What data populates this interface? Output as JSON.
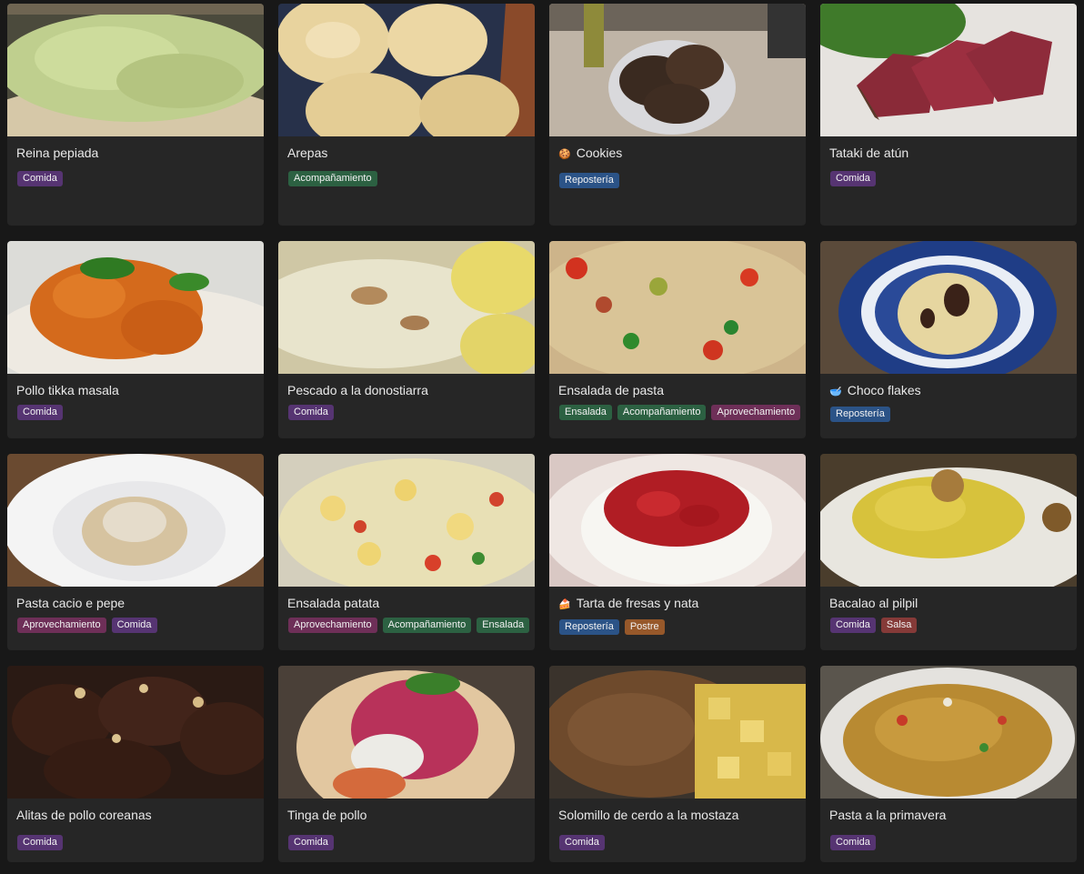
{
  "tag_colors": {
    "Comida": "#563472",
    "Acompañamiento": "#2c6142",
    "Repostería": "#2b5387",
    "Aprovechamiento": "#6e2f58",
    "Ensalada": "#2c6142",
    "Postre": "#97582a",
    "Salsa": "#853a38"
  },
  "recipes": [
    {
      "title": "Reina pepiada",
      "emoji": "",
      "tags": [
        "Comida"
      ]
    },
    {
      "title": "Arepas",
      "emoji": "",
      "tags": [
        "Acompañamiento"
      ]
    },
    {
      "title": "Cookies",
      "emoji": "🍪",
      "tags": [
        "Repostería"
      ]
    },
    {
      "title": "Tataki de atún",
      "emoji": "",
      "tags": [
        "Comida"
      ]
    },
    {
      "title": "Pollo tikka masala",
      "emoji": "",
      "tags": [
        "Comida"
      ]
    },
    {
      "title": "Pescado a la donostiarra",
      "emoji": "",
      "tags": [
        "Comida"
      ]
    },
    {
      "title": "Ensalada de pasta",
      "emoji": "",
      "tags": [
        "Ensalada",
        "Acompañamiento",
        "Aprovechamiento"
      ]
    },
    {
      "title": "Choco flakes",
      "emoji": "🥣",
      "tags": [
        "Repostería"
      ]
    },
    {
      "title": "Pasta cacio e pepe",
      "emoji": "",
      "tags": [
        "Aprovechamiento",
        "Comida"
      ]
    },
    {
      "title": "Ensalada patata",
      "emoji": "",
      "tags": [
        "Aprovechamiento",
        "Acompañamiento",
        "Ensalada"
      ]
    },
    {
      "title": "Tarta de fresas y nata",
      "emoji": "🍰",
      "tags": [
        "Repostería",
        "Postre"
      ]
    },
    {
      "title": "Bacalao al pilpil",
      "emoji": "",
      "tags": [
        "Comida",
        "Salsa"
      ]
    },
    {
      "title": "Alitas de pollo coreanas",
      "emoji": "",
      "tags": [
        "Comida"
      ]
    },
    {
      "title": "Tinga de pollo",
      "emoji": "",
      "tags": [
        "Comida"
      ]
    },
    {
      "title": "Solomillo de cerdo a la mostaza",
      "emoji": "",
      "tags": [
        "Comida"
      ]
    },
    {
      "title": "Pasta a la primavera",
      "emoji": "",
      "tags": [
        "Comida"
      ]
    }
  ]
}
